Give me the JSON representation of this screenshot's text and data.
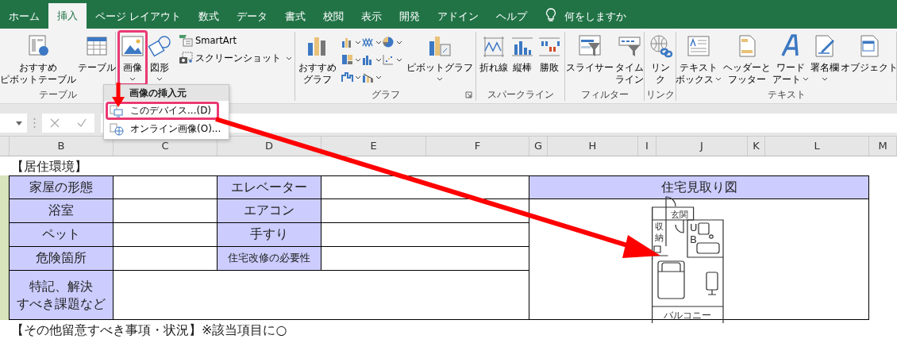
{
  "tabs": [
    {
      "label": "ホーム",
      "selected": false
    },
    {
      "label": "挿入",
      "selected": true
    },
    {
      "label": "ページ レイアウト",
      "selected": false
    },
    {
      "label": "数式",
      "selected": false
    },
    {
      "label": "データ",
      "selected": false
    },
    {
      "label": "書式",
      "selected": false
    },
    {
      "label": "校閲",
      "selected": false
    },
    {
      "label": "表示",
      "selected": false
    },
    {
      "label": "開発",
      "selected": false
    },
    {
      "label": "アドイン",
      "selected": false
    },
    {
      "label": "ヘルプ",
      "selected": false
    }
  ],
  "tell_me": "何をしますか",
  "ribbon_groups": [
    {
      "label": "テーブル",
      "buttons": [
        {
          "lines": [
            "おすすめ",
            "ピボットテーブル"
          ],
          "kind": "large",
          "menu": false
        },
        {
          "lines": [
            "テーブル"
          ],
          "kind": "large",
          "menu": false
        }
      ]
    },
    {
      "buttons": [
        {
          "lines": [
            "画像"
          ],
          "kind": "large",
          "menu": true,
          "annotated": true
        },
        {
          "lines": [
            "図形"
          ],
          "kind": "large",
          "menu": true
        },
        {
          "lines": [
            "SmartArt"
          ],
          "kind": "small",
          "menu": false
        },
        {
          "lines": [
            "スクリーンショット"
          ],
          "kind": "small",
          "menu": true
        }
      ]
    },
    {
      "label": "グラフ",
      "launcher": true,
      "buttons": [
        {
          "lines": [
            "おすすめ",
            "グラフ"
          ],
          "kind": "large",
          "menu": false
        },
        {
          "lines": [
            "ピボットグラフ"
          ],
          "kind": "large",
          "menu": true
        }
      ]
    },
    {
      "label": "スパークライン",
      "buttons": [
        {
          "lines": [
            "折れ線"
          ],
          "kind": "large",
          "menu": false
        },
        {
          "lines": [
            "縦棒"
          ],
          "kind": "large",
          "menu": false
        },
        {
          "lines": [
            "勝敗"
          ],
          "kind": "large",
          "menu": false
        }
      ]
    },
    {
      "label": "フィルター",
      "buttons": [
        {
          "lines": [
            "スライサー"
          ],
          "kind": "large",
          "menu": false
        },
        {
          "lines": [
            "タイム",
            "ライン"
          ],
          "kind": "large",
          "menu": false
        }
      ]
    },
    {
      "label": "リンク",
      "buttons": [
        {
          "lines": [
            "リン",
            "ク"
          ],
          "kind": "large",
          "menu": false
        }
      ]
    },
    {
      "label": "テキスト",
      "buttons": [
        {
          "lines": [
            "テキスト",
            "ボックス"
          ],
          "kind": "large",
          "menu": true
        },
        {
          "lines": [
            "ヘッダーと",
            "フッター"
          ],
          "kind": "large",
          "menu": false
        },
        {
          "lines": [
            "ワード",
            "アート"
          ],
          "kind": "large",
          "menu": true
        },
        {
          "lines": [
            "署名欄"
          ],
          "kind": "large",
          "menu": true
        },
        {
          "lines": [
            "オブジェクト"
          ],
          "kind": "large",
          "menu": false
        }
      ]
    }
  ],
  "picture_menu": {
    "title": "画像の挿入元",
    "items": [
      {
        "label": "このデバイス...(D)",
        "annotated": true
      },
      {
        "label": "オンライン画像(O)..."
      }
    ]
  },
  "columns": [
    "B",
    "C",
    "D",
    "E",
    "F",
    "G",
    "H",
    "I",
    "J",
    "K",
    "L",
    "M"
  ],
  "sheet": {
    "title": "【居住環境】",
    "rows": [
      {
        "left": "家屋の形態",
        "right": "エレベーター",
        "small": false
      },
      {
        "left": "浴室",
        "right": "エアコン",
        "small": false
      },
      {
        "left": "ペット",
        "right": "手すり",
        "small": false
      },
      {
        "left": "危険箇所",
        "right": "住宅改修の必要性",
        "small": true
      }
    ],
    "notes_label": [
      "特記、解決",
      "すべき課題など"
    ],
    "floor_plan": {
      "title": "住宅見取り図",
      "entrance": "玄関",
      "storage": "収納",
      "bath": "UB",
      "balcony": "バルコニー"
    },
    "next_title": "【その他留意すべき事項・状況】※該当項目に○"
  }
}
